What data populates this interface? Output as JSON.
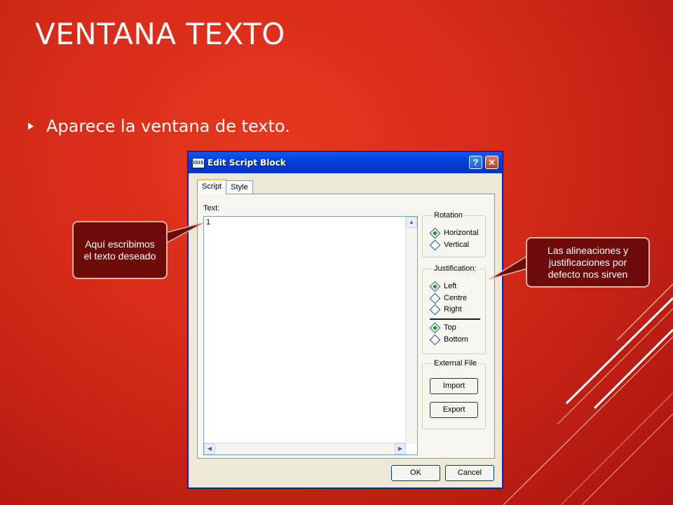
{
  "slide": {
    "title": "VENTANA TEXTO",
    "bullet": "Aparece la ventana de texto."
  },
  "dialog": {
    "icon_label": "ISIS",
    "title": "Edit Script Block",
    "help_label": "?",
    "close_label": "✕",
    "tabs": [
      {
        "label": "Script"
      },
      {
        "label": "Style"
      }
    ],
    "text_label": "Text:",
    "text_value": "1",
    "rotation": {
      "title": "Rotation",
      "options": [
        "Horizontal",
        "Vertical"
      ]
    },
    "justification": {
      "title": "Justification:",
      "options": [
        "Left",
        "Centre",
        "Right"
      ],
      "vertical_options": [
        "Top",
        "Bottom"
      ]
    },
    "external_file": {
      "title": "External File",
      "import_label": "Import",
      "export_label": "Export"
    },
    "ok_label": "OK",
    "cancel_label": "Cancel"
  },
  "callouts": {
    "left": "Aquí escribimos el texto deseado",
    "right": "Las alineaciones y justificaciones por defecto nos sirven"
  },
  "colors": {
    "background": "#d42a18",
    "callout": "#6d0a0a",
    "titlebar": "#0540d8"
  }
}
